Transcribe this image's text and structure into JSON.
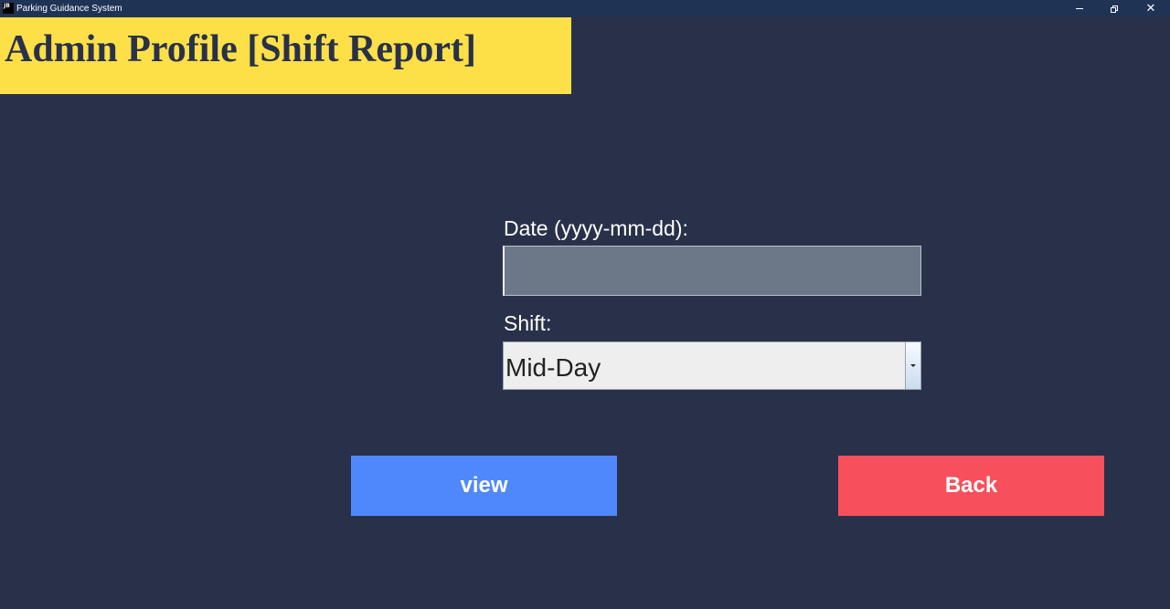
{
  "window": {
    "icon_text": "JB",
    "title": "Parking Guidance System",
    "minimize_icon": "minimize-icon",
    "maximize_icon": "restore-icon",
    "close_icon": "close-icon",
    "close_glyph": "✕"
  },
  "header": {
    "title": "Admin Profile [Shift Report]",
    "band_color": "#fde047",
    "text_color": "#29314a"
  },
  "form": {
    "date_label": "Date (yyyy-mm-dd):",
    "date_value": "",
    "shift_label": "Shift:",
    "shift_selected": "Mid-Day"
  },
  "buttons": {
    "view_label": "view",
    "view_color": "#4f88fb",
    "back_label": "Back",
    "back_color": "#f7505c"
  },
  "colors": {
    "background": "#29314a",
    "titlebar": "#1f3354"
  }
}
